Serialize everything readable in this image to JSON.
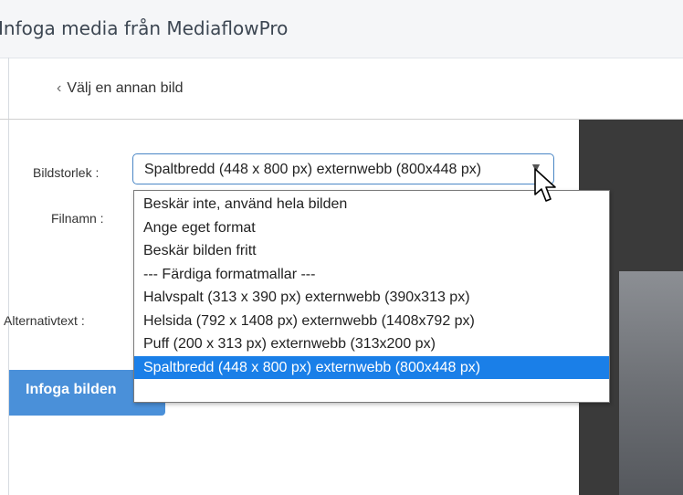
{
  "dialog": {
    "title": "Infoga media från MediaflowPro"
  },
  "back_link": {
    "label": "Välj en annan bild"
  },
  "form": {
    "size_label": "Bildstorlek :",
    "filename_label": "Filnamn :",
    "alt_label": "Alternativtext :",
    "size_value": "Spaltbredd (448 x 800 px) externwebb (800x448 px)",
    "insert_button": "Infoga bilden"
  },
  "dropdown": {
    "options": [
      "Beskär inte, använd hela bilden",
      "Ange eget format",
      "Beskär bilden fritt",
      "--- Färdiga formatmallar ---",
      "Halvspalt (313 x 390 px) externwebb (390x313 px)",
      "Helsida (792 x 1408 px) externwebb (1408x792 px)",
      "Puff (200 x 313 px) externwebb (313x200 px)",
      "Spaltbredd (448 x 800 px) externwebb (800x448 px)"
    ],
    "selected_index": 7
  },
  "colors": {
    "accent": "#4a90d9",
    "selected_option": "#1a7fe8",
    "preview_bg": "#3a3a3a"
  },
  "icons": {
    "back": "chevron-left-icon",
    "dropdown": "chevron-down-icon",
    "pointer": "mouse-cursor-icon"
  }
}
